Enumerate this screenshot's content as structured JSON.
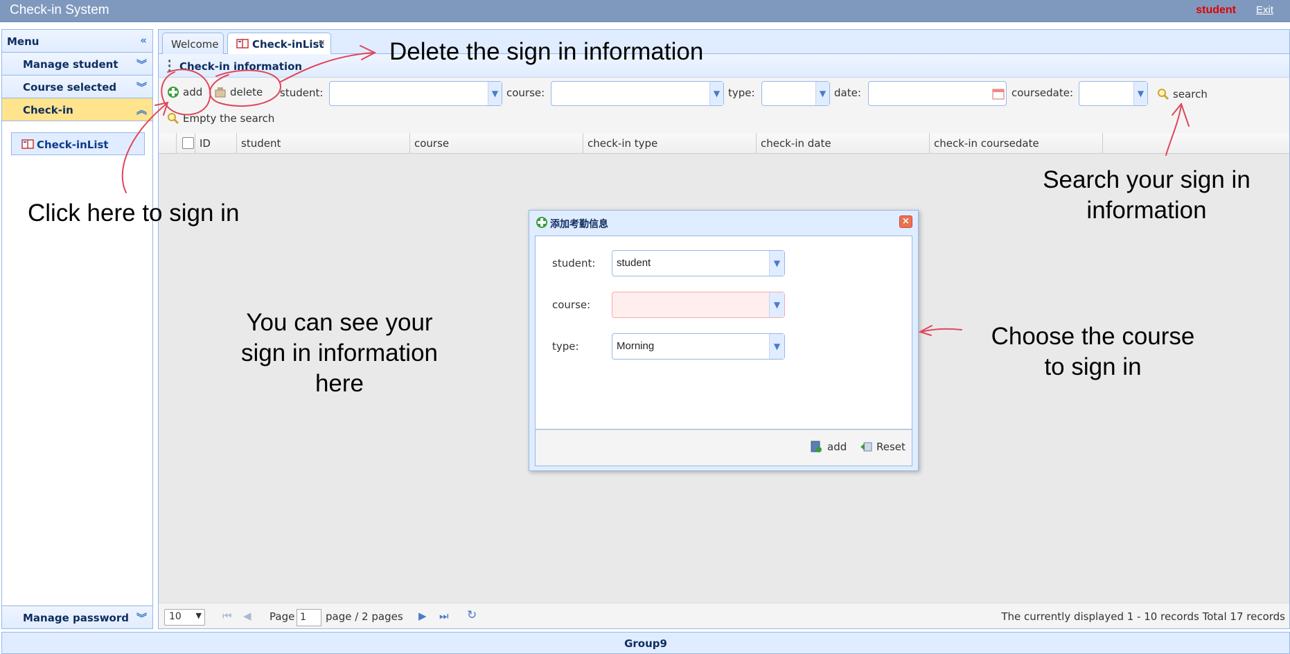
{
  "header": {
    "title": "Check-in System",
    "user": "student",
    "exit": "Exit"
  },
  "sidebar": {
    "menu_label": "Menu",
    "items": [
      {
        "label": "Manage student"
      },
      {
        "label": "Course selected"
      },
      {
        "label": "Check-in"
      }
    ],
    "sub_item": "Check-inList",
    "bottom_item": "Manage password"
  },
  "tabs": [
    {
      "label": "Welcome"
    },
    {
      "label": "Check-inList",
      "close": "×"
    }
  ],
  "panel": {
    "title": "Check-in information"
  },
  "toolbar": {
    "add": "add",
    "delete": "delete",
    "student_label": "student:",
    "course_label": "course:",
    "type_label": "type:",
    "date_label": "date:",
    "coursedate_label": "coursedate:",
    "search": "search",
    "empty_search": "Empty the search"
  },
  "grid": {
    "columns": [
      "ID",
      "student",
      "course",
      "check-in type",
      "check-in date",
      "check-in coursedate"
    ]
  },
  "pager": {
    "page_size": "10",
    "page_label": "Page",
    "page_value": "1",
    "page_suffix": "page / 2 pages",
    "summary": "The currently displayed 1 - 10 records Total 17 records"
  },
  "footer": {
    "text": "Group9"
  },
  "dialog": {
    "title": "添加考勤信息",
    "close": "×",
    "fields": [
      {
        "label": "student:",
        "value": "student"
      },
      {
        "label": "course:",
        "value": ""
      },
      {
        "label": "type:",
        "value": "Morning"
      }
    ],
    "add_button": "add",
    "reset_button": "Reset"
  },
  "annotations": {
    "delete_note": "Delete the sign in information",
    "click_note": "Click here to sign in",
    "see_note_1": "You can see your",
    "see_note_2": "sign in information",
    "see_note_3": "here",
    "search_note_1": "Search your sign in",
    "search_note_2": "information",
    "course_note_1": "Choose the course",
    "course_note_2": "to sign in"
  },
  "colors": {
    "accent": "#95b8e7",
    "header_bg": "#7f99be",
    "active_menu": "#ffe48d",
    "user_red": "#e00000",
    "pen_red": "#e0455a"
  }
}
